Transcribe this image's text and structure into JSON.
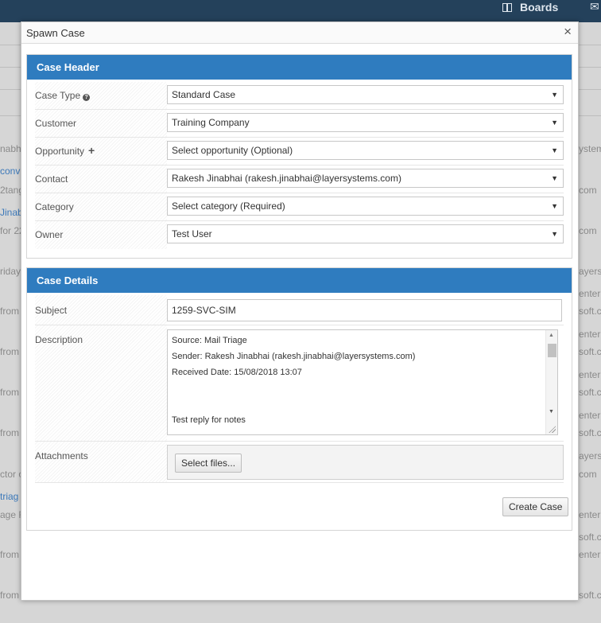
{
  "background": {
    "topbar": {
      "boards_label": "Boards"
    },
    "left_fragments": [
      "nabh",
      "conv",
      "2tang",
      "Jinab",
      "for 22",
      "riday",
      "from",
      "from",
      "from",
      "from",
      "ctor o",
      "triag",
      "age R",
      "from",
      "from"
    ],
    "right_fragments": [
      "ystem",
      "com",
      "com",
      "ayersy",
      "enter",
      "soft.co",
      "enter",
      "soft.co",
      "enter",
      "soft.co",
      "enter",
      "soft.co",
      "ayersy",
      "com",
      "enter",
      "soft.co",
      "enter",
      "soft.co"
    ]
  },
  "modal": {
    "title": "Spawn Case",
    "close_glyph": "×",
    "case_header": {
      "heading": "Case Header",
      "fields": [
        {
          "label": "Case Type",
          "value": "Standard Case"
        },
        {
          "label": "Customer",
          "value": "Training Company"
        },
        {
          "label": "Opportunity",
          "value": "Select opportunity (Optional)"
        },
        {
          "label": "Contact",
          "value": "Rakesh Jinabhai (rakesh.jinabhai@layersystems.com)"
        },
        {
          "label": "Category",
          "value": "Select category (Required)"
        },
        {
          "label": "Owner",
          "value": "Test User"
        }
      ]
    },
    "case_details": {
      "heading": "Case Details",
      "subject_label": "Subject",
      "subject_value": "1259-SVC-SIM",
      "description_label": "Description",
      "description_lines": [
        "Source: Mail Triage",
        "Sender: Rakesh Jinabhai (rakesh.jinabhai@layersystems.com)",
        "Received Date: 15/08/2018 13:07",
        "",
        "",
        "Test reply for notes"
      ],
      "attachments_label": "Attachments",
      "select_files_label": "Select files...",
      "create_case_label": "Create Case"
    }
  }
}
